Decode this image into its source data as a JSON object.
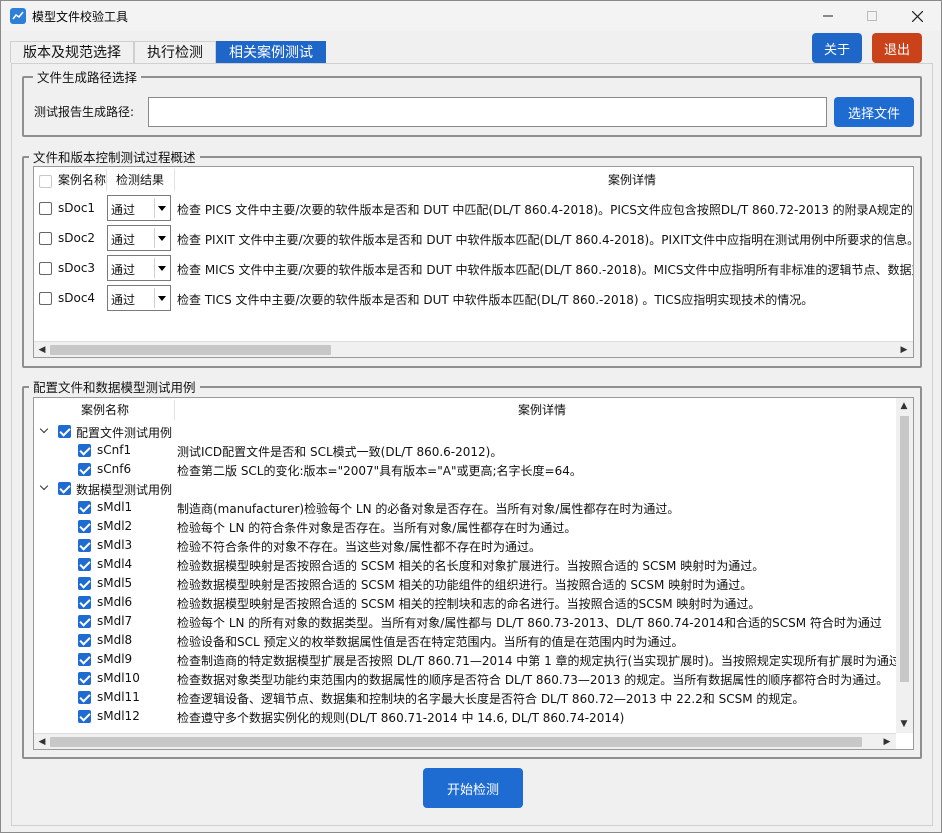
{
  "window": {
    "title": "模型文件校验工具"
  },
  "tabs": [
    "版本及规范选择",
    "执行检测",
    "相关案例测试"
  ],
  "top_buttons": {
    "about": "关于",
    "exit": "退出"
  },
  "file_group": {
    "legend": "文件生成路径选择",
    "path_label": "测试报告生成路径:",
    "path_value": "",
    "choose_button": "选择文件"
  },
  "doc_group": {
    "legend": "文件和版本控制测试过程概述",
    "headers": {
      "name": "案例名称",
      "result": "检测结果",
      "detail": "案例详情"
    },
    "rows": [
      {
        "name": "sDoc1",
        "result": "通过",
        "detail": "检查 PICS 文件中主要/次要的软件版本是否和 DUT 中匹配(DL/T 860.4-2018)。PICS文件应包含按照DL/T 860.72-2013 的附录A规定的ACSI服务"
      },
      {
        "name": "sDoc2",
        "result": "通过",
        "detail": "检查 PIXIT 文件中主要/次要的软件版本是否和 DUT 中软件版本匹配(DL/T 860.4-2018)。PIXIT文件中应指明在测试用例中所要求的信息。"
      },
      {
        "name": "sDoc3",
        "result": "通过",
        "detail": "检查 MICS 文件中主要/次要的软件版本是否和 DUT 中软件版本匹配(DL/T 860.-2018)。MICS文件中应指明所有非标准的逻辑节点、数据对象"
      },
      {
        "name": "sDoc4",
        "result": "通过",
        "detail": "检查 TICS 文件中主要/次要的软件版本是否和 DUT 中软件版本匹配(DL/T 860.-2018) 。TICS应指明实现技术的情况。"
      }
    ]
  },
  "model_group": {
    "legend": "配置文件和数据模型测试用例",
    "headers": {
      "name": "案例名称",
      "detail": "案例详情"
    },
    "groups": [
      {
        "name": "配置文件测试用例",
        "items": [
          {
            "name": "sCnf1",
            "detail": "测试ICD配置文件是否和 SCL模式一致(DL/T 860.6-2012)。"
          },
          {
            "name": "sCnf6",
            "detail": "检查第二版 SCL的变化:版本=\"2007\"具有版本=\"A\"或更高;名字长度=64。"
          }
        ]
      },
      {
        "name": "数据模型测试用例",
        "items": [
          {
            "name": "sMdl1",
            "detail": "制造商(manufacturer)检验每个 LN 的必备对象是否存在。当所有对象/属性都存在时为通过。"
          },
          {
            "name": "sMdl2",
            "detail": "检验每个 LN 的符合条件对象是否存在。当所有对象/属性都存在时为通过。"
          },
          {
            "name": "sMdl3",
            "detail": "检验不符合条件的对象不存在。当这些对象/属性都不存在时为通过。"
          },
          {
            "name": "sMdl4",
            "detail": "检验数据模型映射是否按照合适的 SCSM 相关的名长度和对象扩展进行。当按照合适的 SCSM 映射时为通过。"
          },
          {
            "name": "sMdl5",
            "detail": "检验数据模型映射是否按照合适的 SCSM 相关的功能组件的组织进行。当按照合适的 SCSM 映射时为通过。"
          },
          {
            "name": "sMdl6",
            "detail": "检验数据模型映射是否按照合适的 SCSM 相关的控制块和志的命名进行。当按照合适的SCSM 映射时为通过。"
          },
          {
            "name": "sMdl7",
            "detail": "检验每个 LN 的所有对象的数据类型。当所有对象/属性都与 DL/T 860.73-2013、DL/T 860.74-2014和合适的SCSM 符合时为通过"
          },
          {
            "name": "sMdl8",
            "detail": "检验设备和SCL 预定义的枚举数据属性值是否在特定范围内。当所有的值是在范围内时为通过。"
          },
          {
            "name": "sMdl9",
            "detail": "检查制造商的特定数据模型扩展是否按照 DL/T 860.71—2014 中第 1 章的规定执行(当实现扩展时)。当按照规定实现所有扩展时为通过"
          },
          {
            "name": "sMdl10",
            "detail": "检查数据对象类型功能约束范围内的数据属性的顺序是否符合 DL/T 860.73—2013 的规定。当所有数据属性的顺序都符合时为通过。"
          },
          {
            "name": "sMdl11",
            "detail": "检查逻辑设备、逻辑节点、数据集和控制块的名字最大长度是否符合 DL/T 860.72—2013 中 22.2和 SCSM 的规定。"
          },
          {
            "name": "sMdl12",
            "detail": "检查遵守多个数据实例化的规则(DL/T 860.71-2014 中 14.6, DL/T 860.74-2014)"
          }
        ]
      }
    ]
  },
  "start_button": "开始检测"
}
